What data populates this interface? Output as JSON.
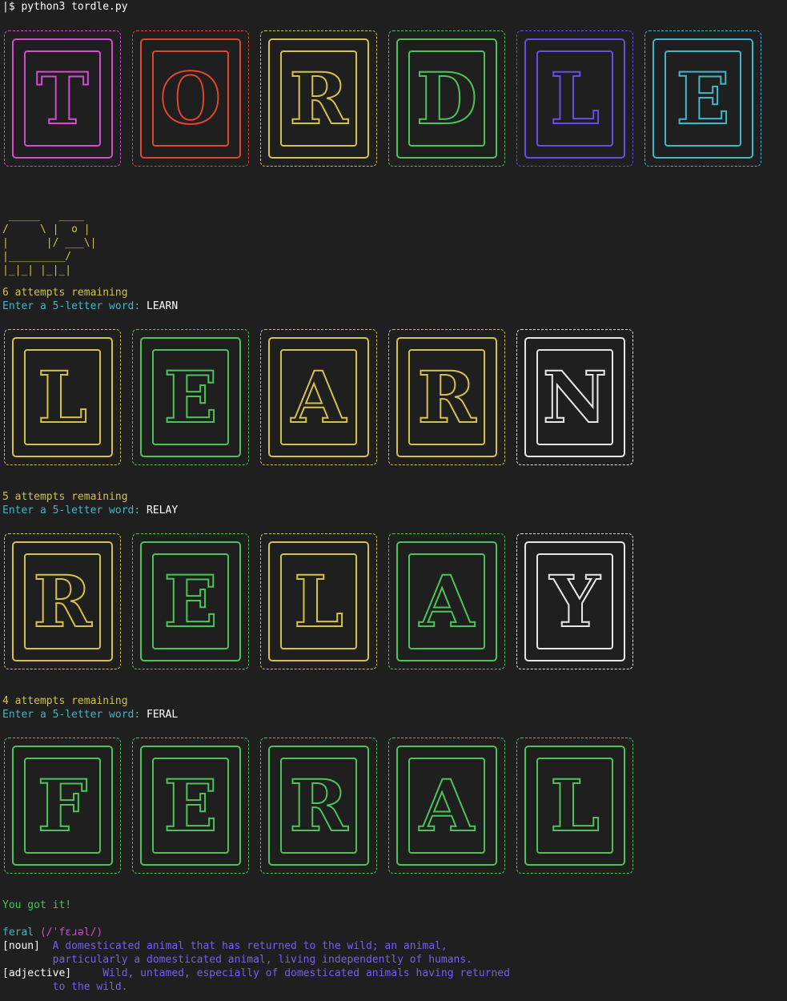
{
  "terminal": {
    "command": "|$ python3 tordle.py"
  },
  "title_tiles": [
    {
      "letter": "T",
      "color": "#d64ad0"
    },
    {
      "letter": "O",
      "color": "#e0452e"
    },
    {
      "letter": "R",
      "color": "#d2c14a"
    },
    {
      "letter": "D",
      "color": "#4ec25a"
    },
    {
      "letter": "L",
      "color": "#6a4de8"
    },
    {
      "letter": "E",
      "color": "#3fb7c8"
    }
  ],
  "mascot_art": " _____   ____\n/     \\ |  o |\n|      |/ ___\\|\n|_________/\n|_|_| |_|_|",
  "turns": [
    {
      "attempts": "6 attempts remaining",
      "prompt": "Enter a 5-letter word: ",
      "word": "LEARN",
      "tiles": [
        {
          "letter": "L",
          "color": "#d2c14a"
        },
        {
          "letter": "E",
          "color": "#4ec25a"
        },
        {
          "letter": "A",
          "color": "#d2c14a"
        },
        {
          "letter": "R",
          "color": "#d2c14a"
        },
        {
          "letter": "N",
          "color": "#e6e6e6"
        }
      ]
    },
    {
      "attempts": "5 attempts remaining",
      "prompt": "Enter a 5-letter word: ",
      "word": "RELAY",
      "tiles": [
        {
          "letter": "R",
          "color": "#d2c14a"
        },
        {
          "letter": "E",
          "color": "#4ec25a"
        },
        {
          "letter": "L",
          "color": "#d2c14a"
        },
        {
          "letter": "A",
          "color": "#4ec25a"
        },
        {
          "letter": "Y",
          "color": "#e6e6e6"
        }
      ]
    },
    {
      "attempts": "4 attempts remaining",
      "prompt": "Enter a 5-letter word: ",
      "word": "FERAL",
      "tiles": [
        {
          "letter": "F",
          "color": "#4ec25a"
        },
        {
          "letter": "E",
          "color": "#4ec25a"
        },
        {
          "letter": "R",
          "color": "#4ec25a"
        },
        {
          "letter": "A",
          "color": "#4ec25a"
        },
        {
          "letter": "L",
          "color": "#4ec25a"
        }
      ]
    }
  ],
  "result": "You got it!",
  "definition": {
    "word": "feral",
    "pron": " (/ˈfɛɹəl/)",
    "senses": [
      {
        "pos": "[noun]",
        "text": "  A domesticated animal that has returned to the wild; an animal,",
        "cont": "        particularly a domesticated animal, living independently of humans."
      },
      {
        "pos": "[adjective]",
        "text": "     Wild, untamed, especially of domesticated animals having returned",
        "cont": "        to the wild."
      }
    ]
  }
}
